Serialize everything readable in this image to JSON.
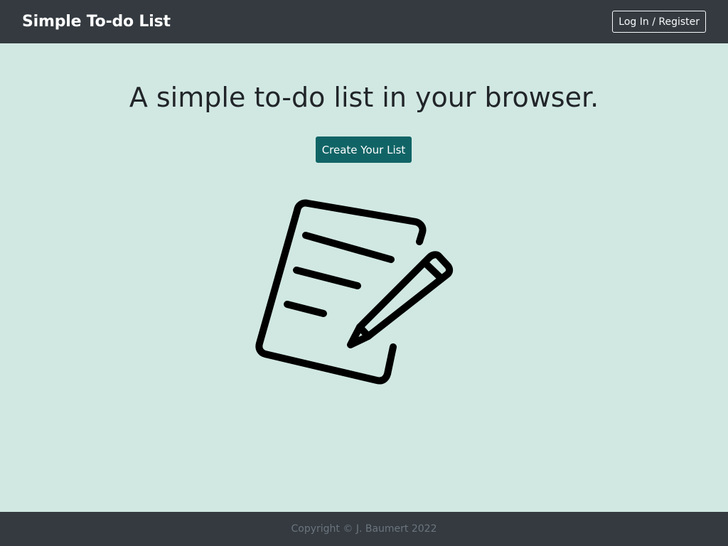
{
  "navbar": {
    "brand": "Simple To-do List",
    "login_label": "Log In / Register"
  },
  "hero": {
    "title": "A simple to-do list in your browser.",
    "cta_label": "Create Your List",
    "illustration_icon": "notepad-pencil-icon"
  },
  "footer": {
    "copyright": "Copyright © J. Baumert 2022"
  },
  "colors": {
    "navbar_bg": "#343a40",
    "page_bg": "#d1e8e2",
    "accent": "#116466",
    "footer_text": "#6c757d"
  }
}
